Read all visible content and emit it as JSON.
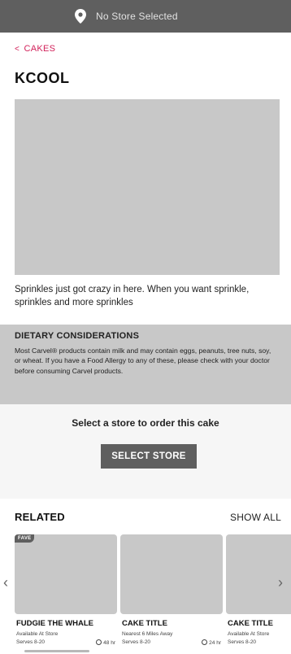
{
  "header": {
    "store_status": "No Store Selected",
    "icon": "location-pin-icon"
  },
  "breadcrumb": {
    "back_label": "CAKES",
    "back_icon": "chevron-left-icon"
  },
  "product": {
    "title": "KCOOL",
    "description": "Sprinkles just got crazy in here. When you want sprinkle, sprinkles and more sprinkles"
  },
  "dietary": {
    "heading": "DIETARY CONSIDERATIONS",
    "body": "Most Carvel® products contain milk and may contain eggs, peanuts, tree nuts, soy, or wheat. If you have a Food Allergy to any of these, please check with your doctor before consuming Carvel products."
  },
  "store_prompt": {
    "text": "Select a store to order this cake",
    "button_label": "SELECT STORE"
  },
  "related": {
    "heading": "RELATED",
    "show_all": "SHOW ALL",
    "cards": [
      {
        "badge": "FAVE",
        "name": "FUDGIE THE WHALE",
        "availability": "Available At Store",
        "serves": "Serves 8-20",
        "time": "48 hr"
      },
      {
        "badge": "",
        "name": "CAKE TITLE",
        "availability": "Nearest 6 Miles Away",
        "serves": "Serves 8-20",
        "time": "24 hr"
      },
      {
        "badge": "",
        "name": "CAKE TITLE",
        "availability": "Available At Store",
        "serves": "Serves 8-20",
        "time": ""
      }
    ]
  },
  "colors": {
    "accent": "#d2215a",
    "header_bg": "#5f5f5f",
    "placeholder": "#c8c8c8"
  }
}
